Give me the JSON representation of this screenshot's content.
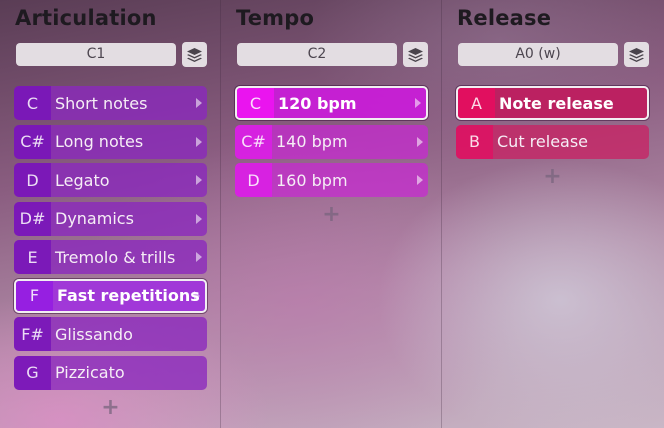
{
  "columns": [
    {
      "title": "Articulation",
      "key_value": "C1",
      "color": "#8a28be",
      "items": [
        {
          "key": "C",
          "label": "Short notes"
        },
        {
          "key": "C#",
          "label": "Long notes"
        },
        {
          "key": "D",
          "label": "Legato"
        },
        {
          "key": "D#",
          "label": "Dynamics"
        },
        {
          "key": "E",
          "label": "Tremolo & trills"
        },
        {
          "key": "F",
          "label": "Fast repetitions",
          "selected": true
        },
        {
          "key": "F#",
          "label": "Glissando"
        },
        {
          "key": "G",
          "label": "Pizzicato"
        }
      ],
      "add_label": "+"
    },
    {
      "title": "Tempo",
      "key_value": "C2",
      "color": "#d228d6",
      "items": [
        {
          "key": "C",
          "label": "120 bpm",
          "selected": true
        },
        {
          "key": "C#",
          "label": "140 bpm"
        },
        {
          "key": "D",
          "label": "160 bpm"
        }
      ],
      "add_label": "+"
    },
    {
      "title": "Release",
      "key_value": "A0 (w)",
      "color": "#d22364",
      "items": [
        {
          "key": "A",
          "label": "Note release",
          "selected": true
        },
        {
          "key": "B",
          "label": "Cut release"
        }
      ],
      "add_label": "+"
    }
  ]
}
